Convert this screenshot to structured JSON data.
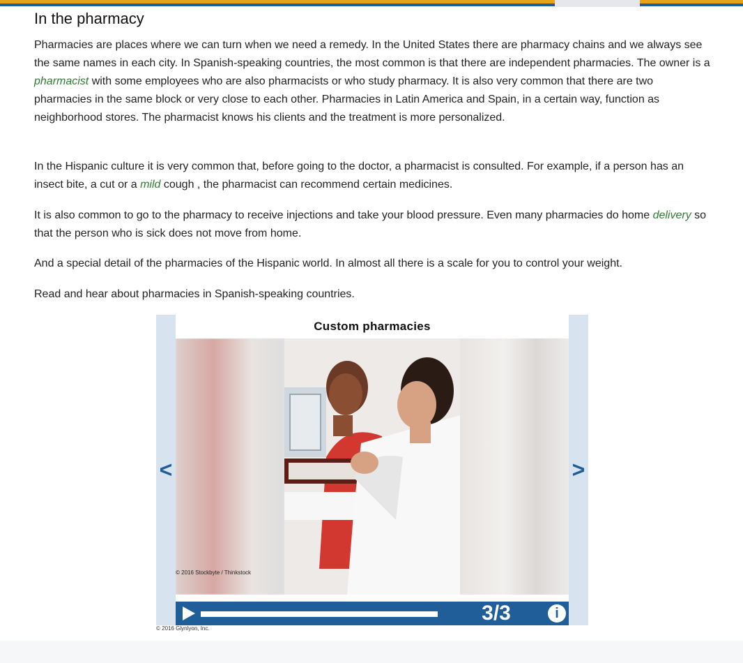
{
  "heading": "In the pharmacy",
  "paragraphs": {
    "p1_part1": "Pharmacies are places where we can turn when we need a remedy. In the United States there are pharmacy chains and we always see the same names in each city. In Spanish-speaking countries, the most common is that there are independent pharmacies. The owner is a ",
    "p1_term": "pharmacist",
    "p1_part2": " with some employees who are also pharmacists or who study pharmacy. It is also very common that there are two pharmacies in the same block or very close to each other. Pharmacies in Latin America and Spain, in a certain way, function as neighborhood stores. The pharmacist knows his clients and the treatment is more personalized.",
    "p2_part1": "In the Hispanic culture it is very common that, before going to the doctor, a pharmacist is consulted. For example, if a person has an insect bite, a cut or a ",
    "p2_term": "mild",
    "p2_part2": " cough , the pharmacist can recommend certain medicines.",
    "p3_part1": "It is also common to go to the pharmacy to receive injections and take your blood pressure. Even many pharmacies do home ",
    "p3_term": "delivery",
    "p3_part2": " so that the person who is sick does not move from home.",
    "p4": "And a special detail of the pharmacies of the Hispanic world. In almost all there is a scale for you to control your weight.",
    "p5": "Read and hear about pharmacies in Spanish-speaking countries."
  },
  "slideshow": {
    "title": "Custom pharmacies",
    "prev_label": "<",
    "next_label": ">",
    "counter": "3/3",
    "info_label": "i",
    "photo_credit": "© 2016 Stockbyte / Thinkstock",
    "progress_fraction": 1.0
  },
  "footer_credit": "© 2016 Glynlyon, Inc.",
  "colors": {
    "accent_blue": "#1f5e98",
    "accent_orange": "#e8a317",
    "glossary_green": "#2e7d32"
  }
}
